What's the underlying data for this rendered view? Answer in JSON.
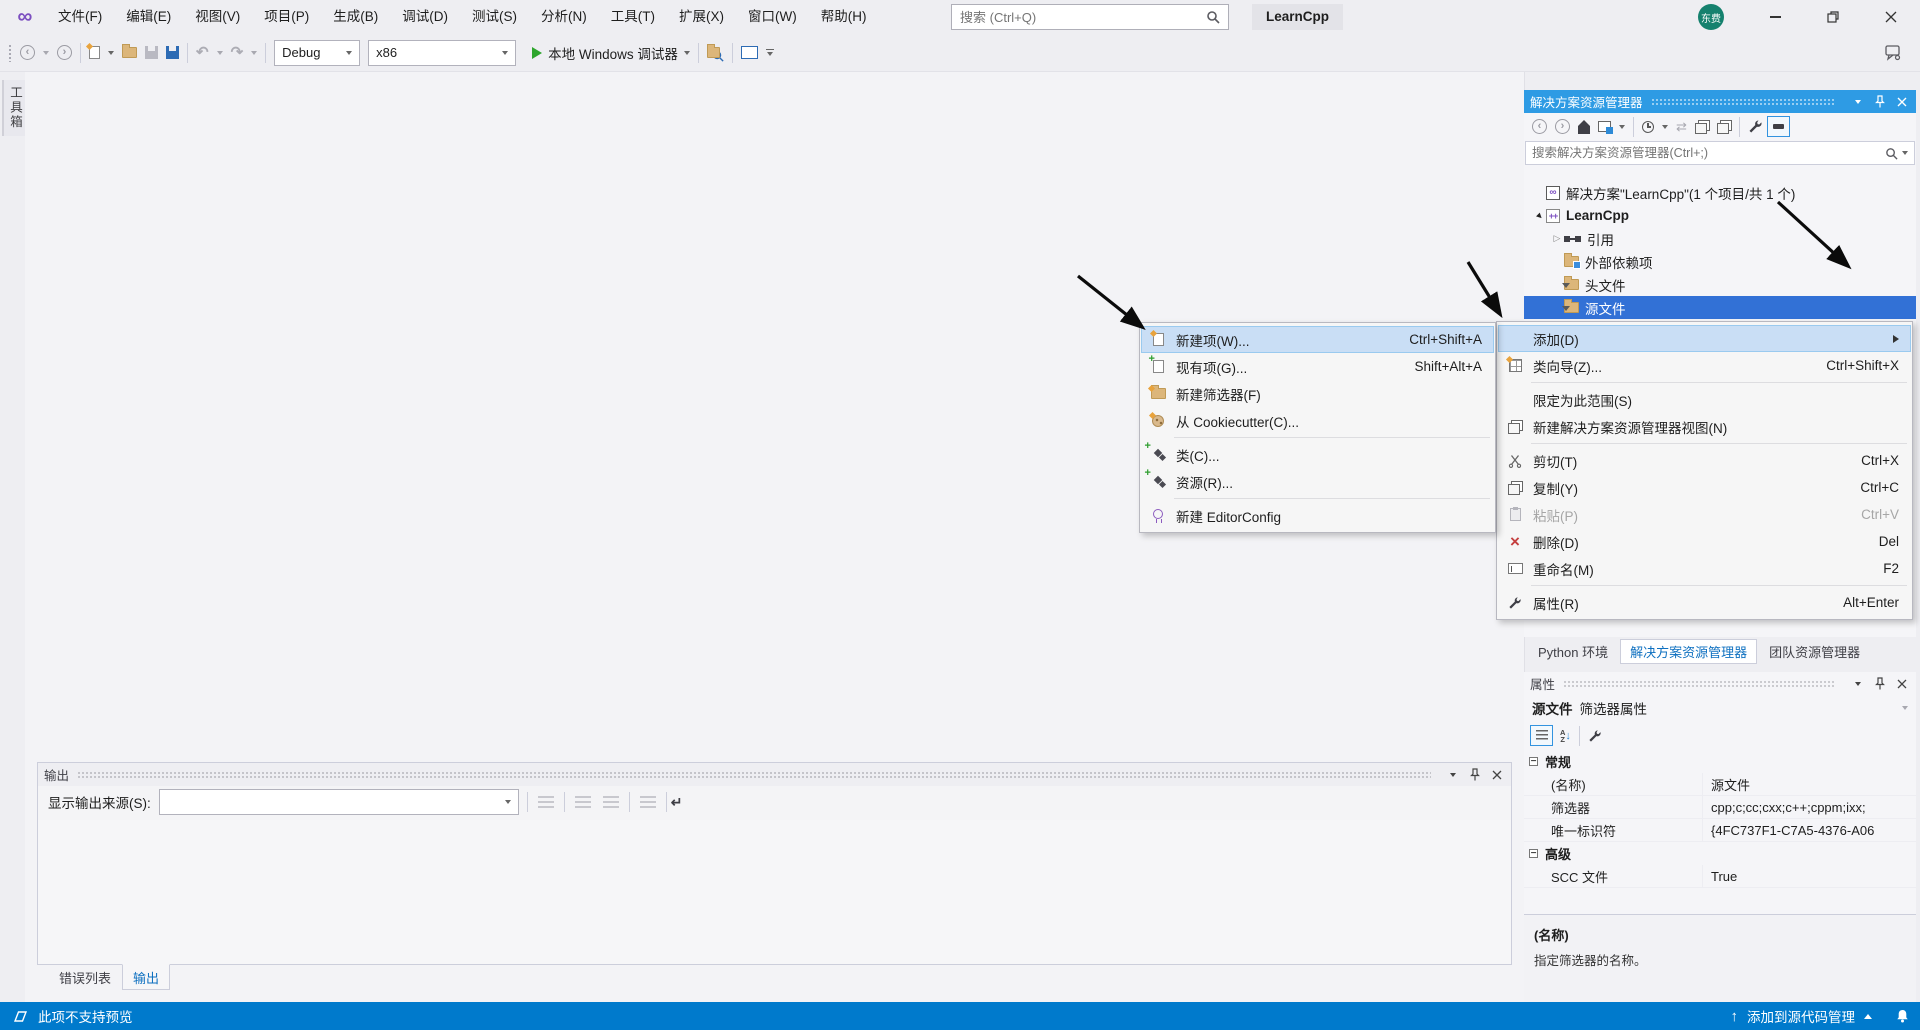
{
  "titlebar": {
    "menu": [
      "文件(F)",
      "编辑(E)",
      "视图(V)",
      "项目(P)",
      "生成(B)",
      "调试(D)",
      "测试(S)",
      "分析(N)",
      "工具(T)",
      "扩展(X)",
      "窗口(W)",
      "帮助(H)"
    ],
    "search_placeholder": "搜索 (Ctrl+Q)",
    "badge": "LearnCpp",
    "avatar": "东费"
  },
  "toolbar": {
    "config": "Debug",
    "platform": "x86",
    "run": "本地 Windows 调试器"
  },
  "toolbox": {
    "tab": "工具箱"
  },
  "solution_explorer": {
    "title": "解决方案资源管理器",
    "search_placeholder": "搜索解决方案资源管理器(Ctrl+;)",
    "tree": {
      "solution": "解决方案\"LearnCpp\"(1 个项目/共 1 个)",
      "project": "LearnCpp",
      "references": "引用",
      "external": "外部依赖项",
      "headers": "头文件",
      "sources": "源文件"
    },
    "dock_tabs": [
      "Python 环境",
      "解决方案资源管理器",
      "团队资源管理器"
    ]
  },
  "context_menu": {
    "items": [
      {
        "label": "添加(D)",
        "shortcut": ""
      },
      {
        "label": "类向导(Z)...",
        "shortcut": "Ctrl+Shift+X"
      },
      {
        "label": "限定为此范围(S)",
        "shortcut": ""
      },
      {
        "label": "新建解决方案资源管理器视图(N)",
        "shortcut": ""
      },
      {
        "label": "剪切(T)",
        "shortcut": "Ctrl+X"
      },
      {
        "label": "复制(Y)",
        "shortcut": "Ctrl+C"
      },
      {
        "label": "粘贴(P)",
        "shortcut": "Ctrl+V"
      },
      {
        "label": "删除(D)",
        "shortcut": "Del"
      },
      {
        "label": "重命名(M)",
        "shortcut": "F2"
      },
      {
        "label": "属性(R)",
        "shortcut": "Alt+Enter"
      }
    ]
  },
  "add_submenu": {
    "items": [
      {
        "label": "新建项(W)...",
        "shortcut": "Ctrl+Shift+A"
      },
      {
        "label": "现有项(G)...",
        "shortcut": "Shift+Alt+A"
      },
      {
        "label": "新建筛选器(F)",
        "shortcut": ""
      },
      {
        "label": "从 Cookiecutter(C)...",
        "shortcut": ""
      },
      {
        "label": "类(C)...",
        "shortcut": ""
      },
      {
        "label": "资源(R)...",
        "shortcut": ""
      },
      {
        "label": "新建 EditorConfig",
        "shortcut": ""
      }
    ]
  },
  "properties": {
    "title": "属性",
    "object_name": "源文件",
    "object_type": "筛选器属性",
    "general": {
      "name": "常规",
      "rows": [
        {
          "name": "(名称)",
          "value": "源文件"
        },
        {
          "name": "筛选器",
          "value": "cpp;c;cc;cxx;c++;cppm;ixx;"
        },
        {
          "name": "唯一标识符",
          "value": "{4FC737F1-C7A5-4376-A06"
        }
      ]
    },
    "advanced": {
      "name": "高级",
      "rows": [
        {
          "name": "SCC 文件",
          "value": "True"
        }
      ]
    },
    "description_title": "(名称)",
    "description_text": "指定筛选器的名称。"
  },
  "output": {
    "title": "输出",
    "source_label": "显示输出来源(S):",
    "tabs": [
      "错误列表",
      "输出"
    ]
  },
  "statusbar": {
    "left": "此项不支持预览",
    "right": "添加到源代码管理"
  },
  "icons": {
    "search-icon": "magnifier-svg",
    "pin-icon": "pushpin-svg",
    "close-icon": "x-svg",
    "window-menu-icon": "caret-down",
    "run-icon": "green-play-triangle",
    "cut-icon": "scissors-svg",
    "delete-icon": "red-x",
    "properties-icon": "wrench-svg",
    "bell-icon": "bell-svg",
    "preview-icon": "parallelogram-outline"
  },
  "colors": {
    "statusbar_blue": "#007ACC",
    "panel_header_blue": "#2E9BE4",
    "selection_blue": "#3271D6",
    "menu_highlight": "#C9DEF5",
    "folder_gold": "#DCB67A",
    "run_green": "#2DA52D",
    "logo_purple": "#7C4FC0"
  }
}
